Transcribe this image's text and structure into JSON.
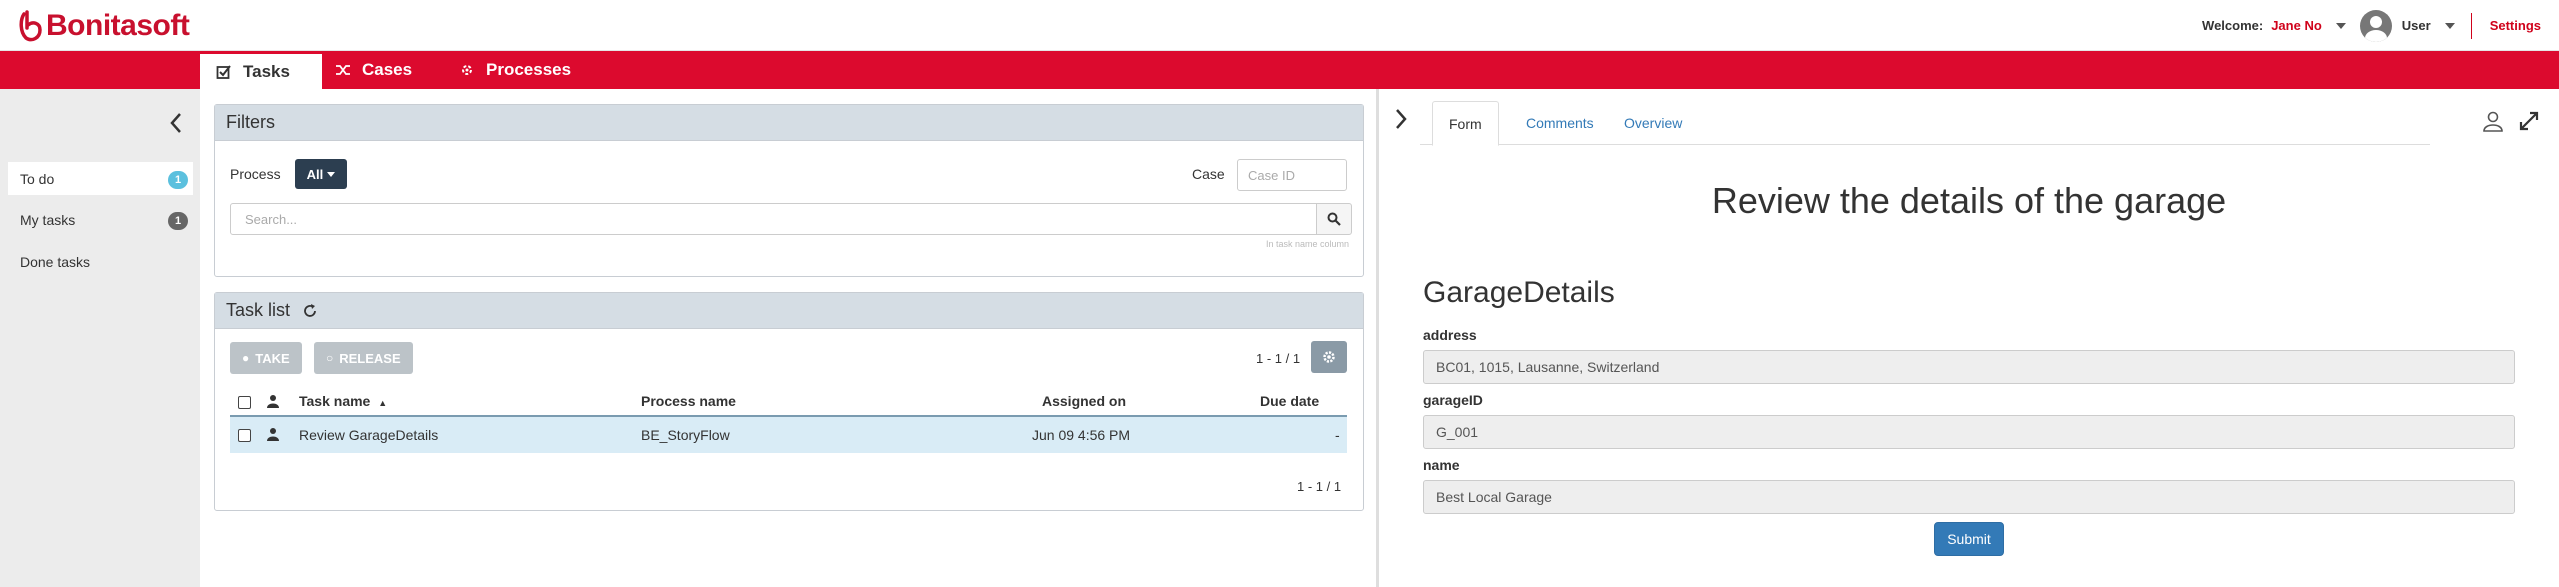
{
  "header": {
    "logo_text": "Bonitasoft",
    "welcome_label": "Welcome:",
    "user_name": "Jane No",
    "role_label": "User",
    "settings_label": "Settings",
    "brand_color": "#dc0a2e"
  },
  "nav": {
    "tabs": [
      {
        "label": "Tasks",
        "icon": "check-square-icon",
        "active": true
      },
      {
        "label": "Cases",
        "icon": "random-icon",
        "active": false
      },
      {
        "label": "Processes",
        "icon": "cogs-icon",
        "active": false
      }
    ]
  },
  "sidebar": {
    "items": [
      {
        "label": "To do",
        "count": "1",
        "active": true
      },
      {
        "label": "My tasks",
        "count": "1",
        "active": false
      },
      {
        "label": "Done tasks",
        "count": "",
        "active": false
      }
    ]
  },
  "filters": {
    "title": "Filters",
    "process_label": "Process",
    "process_value": "All",
    "case_label": "Case",
    "case_placeholder": "Case ID",
    "search_placeholder": "Search...",
    "search_hint": "In task name column"
  },
  "tasklist": {
    "title": "Task list",
    "take_label": "TAKE",
    "release_label": "RELEASE",
    "pager_top": "1 - 1 / 1",
    "pager_bottom": "1 - 1 / 1",
    "columns": [
      "Task name",
      "Process name",
      "Assigned on",
      "Due date"
    ],
    "rows": [
      {
        "task_name": "Review GarageDetails",
        "process_name": "BE_StoryFlow",
        "assigned_on": "Jun 09 4:56 PM",
        "due_date": "-"
      }
    ]
  },
  "detail": {
    "tabs": [
      "Form",
      "Comments",
      "Overview"
    ],
    "active_tab": "Form"
  },
  "form": {
    "title": "Review the details of the garage",
    "subtitle": "GarageDetails",
    "fields": [
      {
        "label": "address",
        "value": "BC01, 1015, Lausanne, Switzerland"
      },
      {
        "label": "garageID",
        "value": "G_001"
      },
      {
        "label": "name",
        "value": "Best Local Garage"
      }
    ],
    "submit_label": "Submit"
  }
}
